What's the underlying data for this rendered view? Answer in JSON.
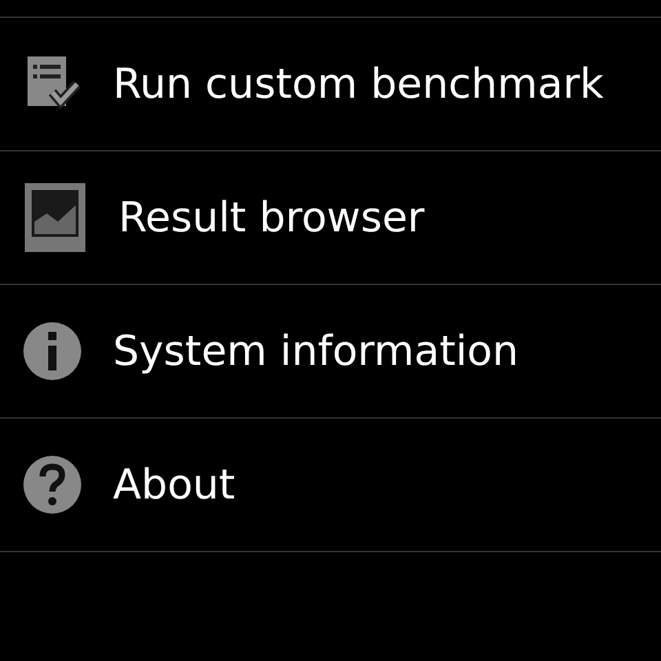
{
  "menu": [
    {
      "kind": "checklist",
      "label": "Run custom benchmark"
    },
    {
      "kind": "chart",
      "label": "Result browser"
    },
    {
      "kind": "info",
      "label": "System information"
    },
    {
      "kind": "help",
      "label": "About"
    }
  ]
}
